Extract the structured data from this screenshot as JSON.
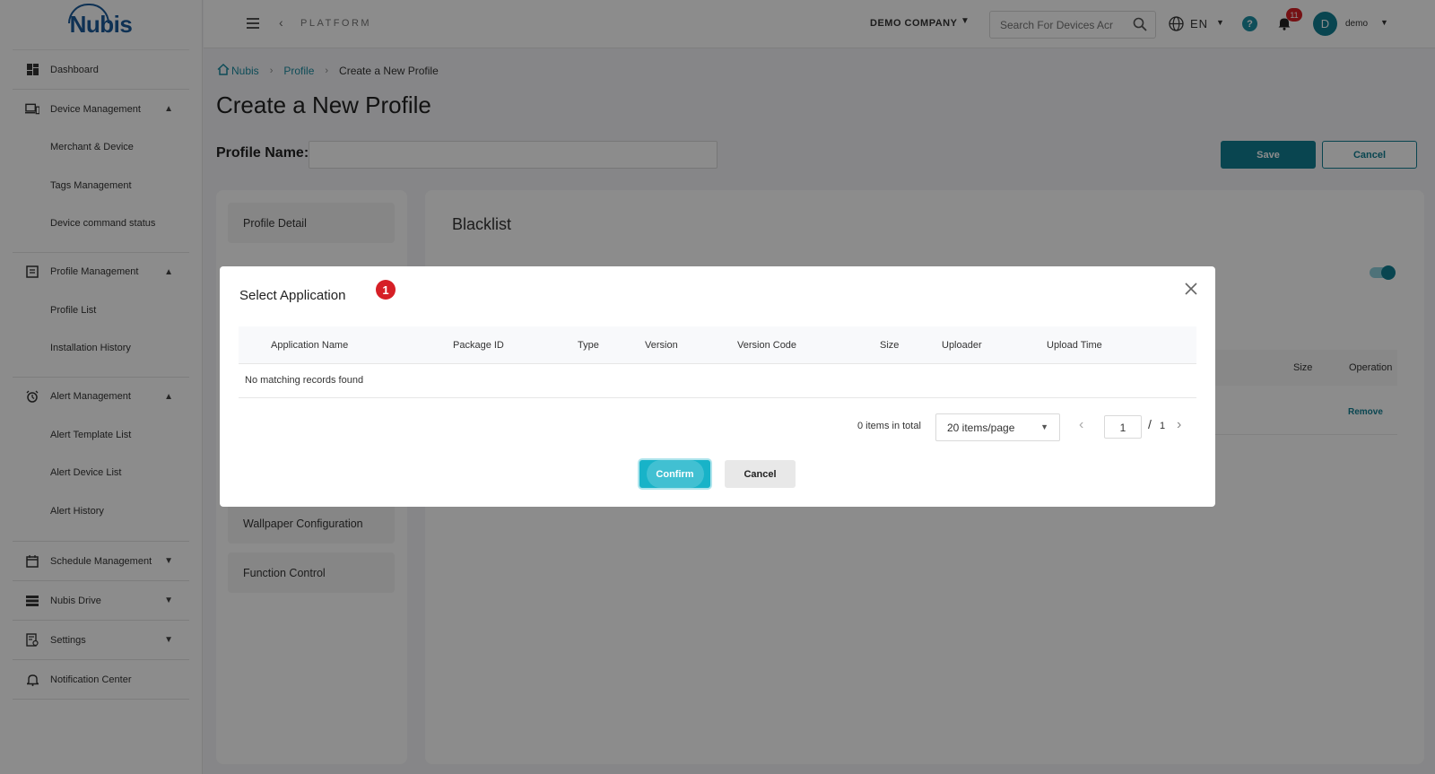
{
  "brand": {
    "logo_text": "Nubis"
  },
  "sidebar": {
    "dashboard": "Dashboard",
    "device_management": "Device Management",
    "merchant_device": "Merchant & Device",
    "tags_management": "Tags Management",
    "device_command_status": "Device command status",
    "profile_management": "Profile Management",
    "profile_list": "Profile List",
    "installation_history": "Installation History",
    "alert_management": "Alert Management",
    "alert_template_list": "Alert Template List",
    "alert_device_list": "Alert Device List",
    "alert_history": "Alert History",
    "schedule_management": "Schedule Management",
    "nubis_drive": "Nubis Drive",
    "settings": "Settings",
    "notification_center": "Notification Center"
  },
  "header": {
    "platform": "PLATFORM",
    "company": "DEMO COMPANY",
    "search_placeholder": "Search For Devices Acr",
    "language": "EN",
    "help": "?",
    "notification_count": "11",
    "avatar_initial": "D",
    "username": "demo"
  },
  "breadcrumb": {
    "home": "Nubis",
    "profile": "Profile",
    "current": "Create a New Profile"
  },
  "page": {
    "title": "Create a New Profile",
    "profile_name_label": "Profile Name:",
    "profile_name_value": "",
    "save": "Save",
    "cancel": "Cancel"
  },
  "profile_menu": {
    "profile_detail": "Profile Detail",
    "wallpaper_configuration": "Wallpaper Configuration",
    "function_control": "Function Control"
  },
  "blacklist": {
    "title": "Blacklist",
    "enabled": true,
    "col_size": "Size",
    "col_operation": "Operation",
    "remove": "Remove"
  },
  "modal": {
    "title": "Select Application",
    "step": "1",
    "columns": [
      "Application Name",
      "Package ID",
      "Type",
      "Version",
      "Version Code",
      "Size",
      "Uploader",
      "Upload Time"
    ],
    "empty_text": "No matching records found",
    "total": "0 items in total",
    "page_size": "20 items/page",
    "current_page": "1",
    "page_sep": "/",
    "total_pages": "1",
    "confirm": "Confirm",
    "cancel": "Cancel"
  },
  "colors": {
    "primary": "#117f93",
    "confirm": "#18b3c8",
    "badge": "#d61f26"
  },
  "icons": [
    "dashboard-icon",
    "device-icon",
    "profile-icon",
    "alarm-clock-icon",
    "calendar-icon",
    "drive-icon",
    "settings-icon",
    "bell-icon",
    "search-icon",
    "globe-icon",
    "close-icon",
    "home-icon"
  ]
}
